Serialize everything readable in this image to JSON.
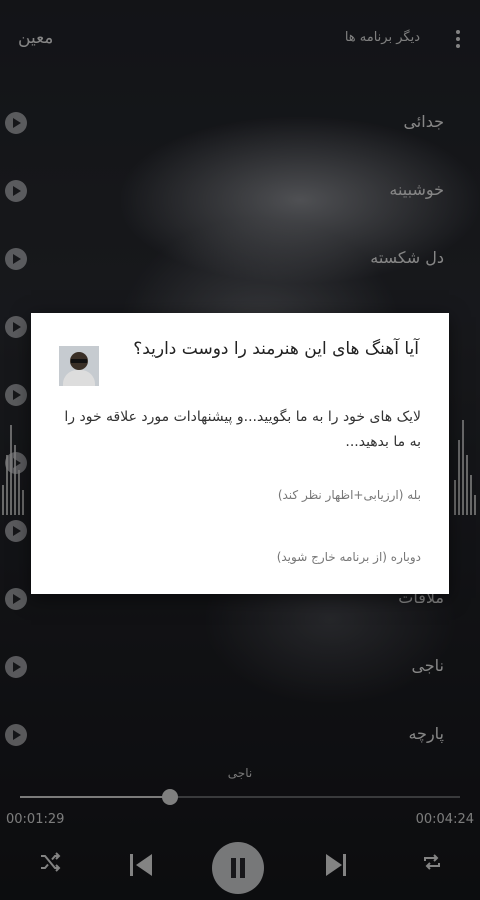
{
  "header": {
    "app_title": "معین",
    "more_apps_label": "دیگر برنامه ها"
  },
  "songs": [
    {
      "title": "جدائی"
    },
    {
      "title": "خوشبینه"
    },
    {
      "title": "دل شکسته"
    },
    {
      "title": ""
    },
    {
      "title": ""
    },
    {
      "title": ""
    },
    {
      "title": ""
    },
    {
      "title": "ملاقات"
    },
    {
      "title": "ناجی"
    },
    {
      "title": "پارچه"
    }
  ],
  "player": {
    "now_playing": "ناجی",
    "elapsed": "00:01:29",
    "total": "00:04:24",
    "progress": 0.34
  },
  "dialog": {
    "title": "آیا آهنگ های این هنرمند را دوست دارید؟",
    "message": "لایک های خود را به ما بگویید...و پیشنهادات مورد علاقه خود را به ما بدهید...",
    "option_yes": "بله (ارزیابی+اظهار نظر کند)",
    "option_again": "دوباره (از برنامه خارج شوید)"
  },
  "icons": {
    "menu": "more-vertical-icon",
    "play": "play-icon",
    "shuffle": "shuffle-icon",
    "previous": "skip-previous-icon",
    "pause": "pause-icon",
    "next": "skip-next-icon",
    "repeat": "repeat-icon"
  }
}
